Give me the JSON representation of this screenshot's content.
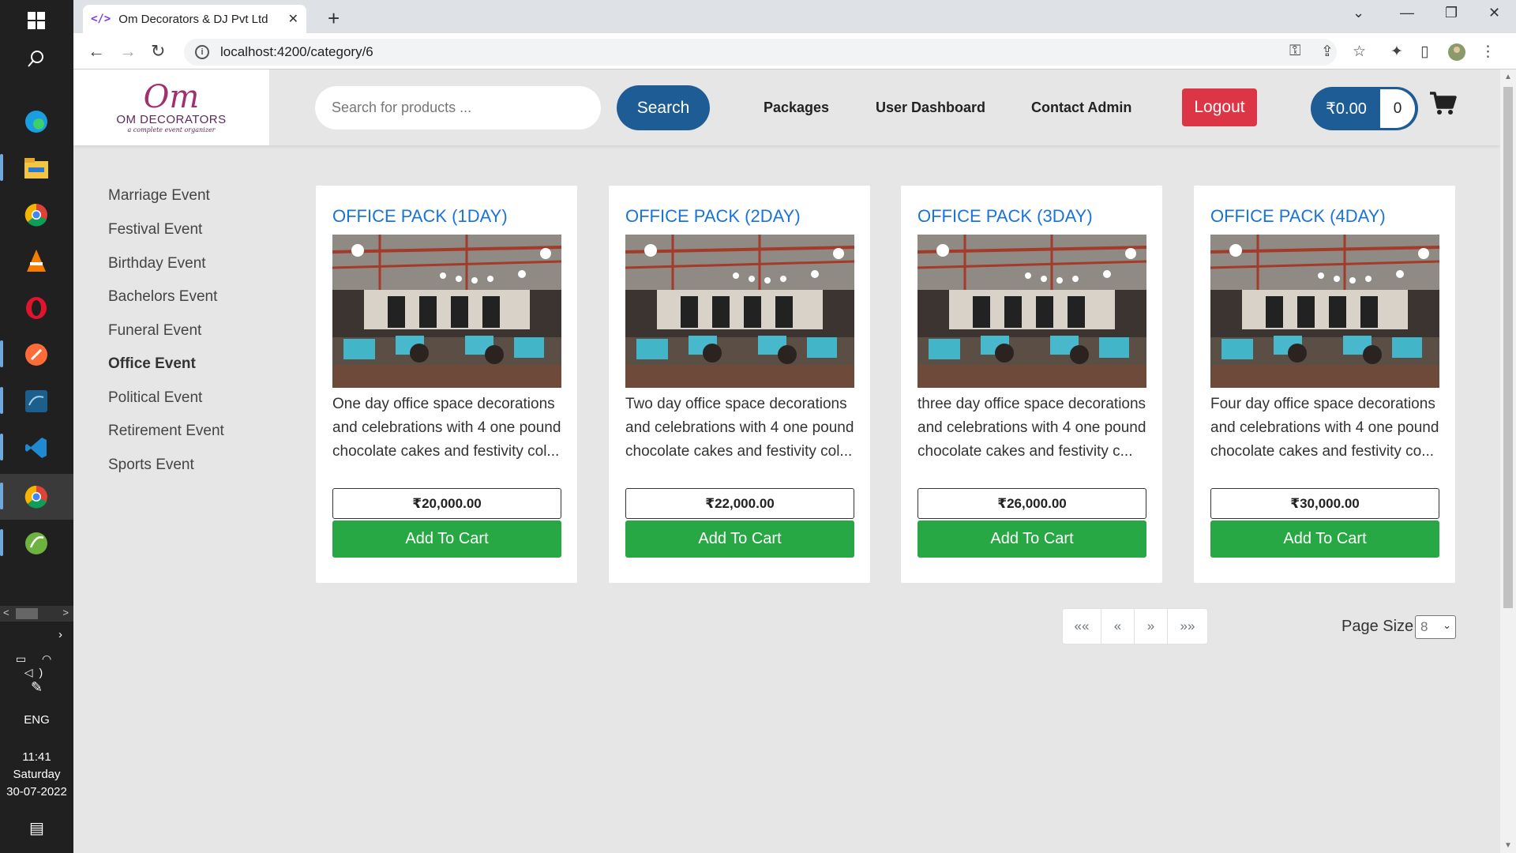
{
  "taskbar": {
    "lang": "ENG",
    "time": "11:41",
    "day": "Saturday",
    "date": "30-07-2022"
  },
  "browser": {
    "tab_title": "Om Decorators & DJ Pvt Ltd",
    "tab_favicon": "</>",
    "url": "localhost:4200/category/6"
  },
  "header": {
    "logo_name": "OM DECORATORS",
    "logo_tagline": "a complete event organizer",
    "search_placeholder": "Search for products ...",
    "search_label": "Search",
    "nav_links": [
      "Packages",
      "User Dashboard",
      "Contact Admin"
    ],
    "logout_label": "Logout",
    "cart_amount": "₹0.00",
    "cart_count": "0"
  },
  "categories": [
    {
      "label": "Marriage Event",
      "active": false
    },
    {
      "label": "Festival Event",
      "active": false
    },
    {
      "label": "Birthday Event",
      "active": false
    },
    {
      "label": "Bachelors Event",
      "active": false
    },
    {
      "label": "Funeral Event",
      "active": false
    },
    {
      "label": "Office Event",
      "active": true
    },
    {
      "label": "Political Event",
      "active": false
    },
    {
      "label": "Retirement Event",
      "active": false
    },
    {
      "label": "Sports Event",
      "active": false
    }
  ],
  "products": [
    {
      "title": "OFFICE PACK (1DAY)",
      "description": "One day office space decorations and celebrations with 4 one pound chocolate cakes and festivity col...",
      "price": "₹20,000.00",
      "button": "Add To Cart"
    },
    {
      "title": "OFFICE PACK (2DAY)",
      "description": "Two day office space decorations and celebrations with 4 one pound chocolate cakes and festivity col...",
      "price": "₹22,000.00",
      "button": "Add To Cart"
    },
    {
      "title": "OFFICE PACK (3DAY)",
      "description": "three day office space decorations and celebrations with 4 one pound chocolate cakes and festivity c...",
      "price": "₹26,000.00",
      "button": "Add To Cart"
    },
    {
      "title": "OFFICE PACK (4DAY)",
      "description": "Four day office space decorations and celebrations with 4 one pound chocolate cakes and festivity co...",
      "price": "₹30,000.00",
      "button": "Add To Cart"
    }
  ],
  "pagination": {
    "first": "««",
    "prev": "«",
    "next": "»",
    "last": "»»",
    "page_size_label": "Page Size",
    "page_size_value": "8"
  },
  "colors": {
    "primary": "#1e5c96",
    "danger": "#dc3545",
    "success": "#28a745",
    "title_link": "#1a73d9"
  }
}
